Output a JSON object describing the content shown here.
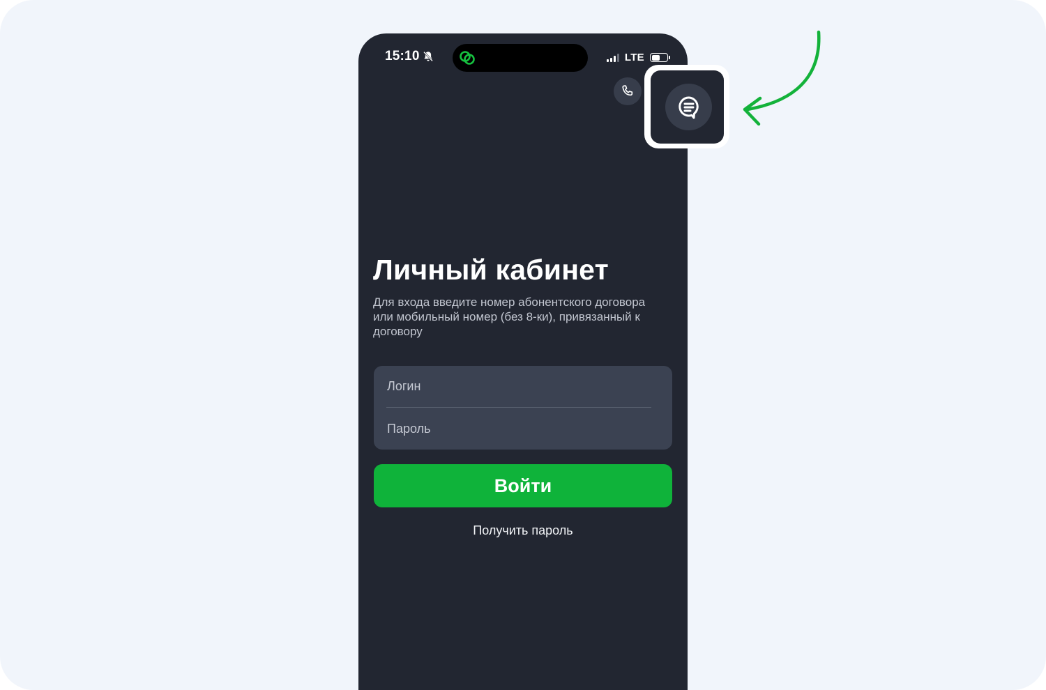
{
  "status_bar": {
    "time": "15:10",
    "network": "LTE",
    "icons": [
      "bell-off-icon",
      "linked-circles-icon",
      "signal-icon",
      "battery-icon"
    ]
  },
  "header": {
    "phone_icon": "phone-icon",
    "chat_icon": "chat-bubble-icon"
  },
  "main": {
    "title": "Личный кабинет",
    "subtitle": "Для входа введите номер абонентского договора или мобильный номер (без 8-ки), привязанный к договору",
    "login_placeholder": "Логин",
    "password_placeholder": "Пароль",
    "login_button": "Войти",
    "get_password_link": "Получить пароль"
  },
  "colors": {
    "page_background": "#f1f5fb",
    "app_background": "#222631",
    "field_background": "#3b4252",
    "accent_green": "#0fb33a"
  }
}
